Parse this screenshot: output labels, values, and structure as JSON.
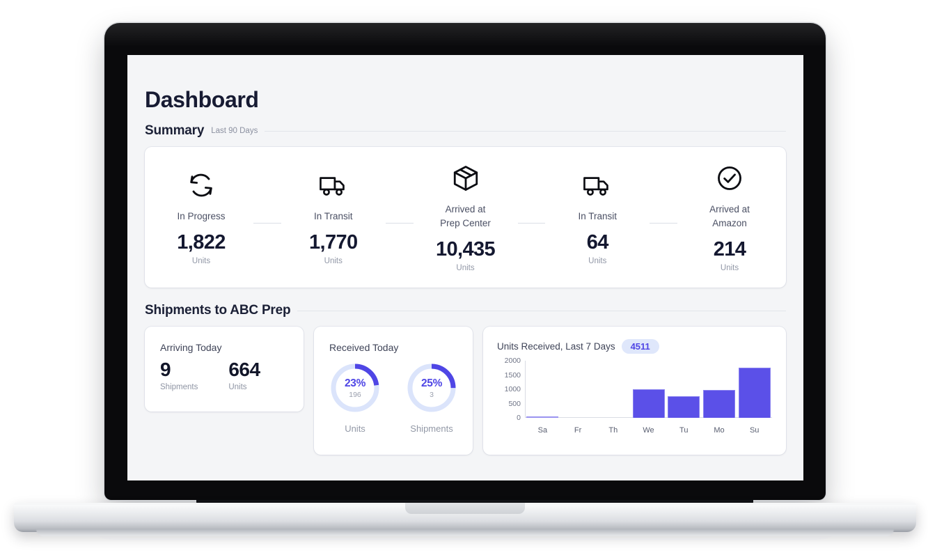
{
  "page": {
    "title": "Dashboard"
  },
  "summary": {
    "heading": "Summary",
    "subheading": "Last 90 Days",
    "items": [
      {
        "icon": "refresh-icon",
        "label": "In Progress",
        "value": "1,822",
        "units": "Units"
      },
      {
        "icon": "truck-icon",
        "label": "In Transit",
        "value": "1,770",
        "units": "Units"
      },
      {
        "icon": "box-icon",
        "label": "Arrived at\nPrep Center",
        "label_line1": "Arrived at",
        "label_line2": "Prep Center",
        "value": "10,435",
        "units": "Units"
      },
      {
        "icon": "truck-icon",
        "label": "In Transit",
        "value": "64",
        "units": "Units"
      },
      {
        "icon": "check-circle-icon",
        "label": "Arrived at\nAmazon",
        "label_line1": "Arrived at",
        "label_line2": "Amazon",
        "value": "214",
        "units": "Units"
      }
    ]
  },
  "shipments": {
    "heading": "Shipments to ABC Prep",
    "arriving_today": {
      "title": "Arriving Today",
      "shipments_value": "9",
      "shipments_caption": "Shipments",
      "units_value": "664",
      "units_caption": "Units"
    },
    "received_today": {
      "title": "Received Today",
      "donuts": [
        {
          "percent_label": "23%",
          "percent": 23,
          "sub": "196",
          "caption": "Units"
        },
        {
          "percent_label": "25%",
          "percent": 25,
          "sub": "3",
          "caption": "Shipments"
        }
      ]
    }
  },
  "colors": {
    "accent": "#4f46e5",
    "bar": "#5b50e8",
    "track": "#dbe4fb",
    "badge_bg": "#dfe7fb",
    "page_bg": "#f4f5f7"
  },
  "chart_data": {
    "type": "bar",
    "title": "Units Received, Last 7 Days",
    "total_badge": "4511",
    "categories": [
      "Sa",
      "Fr",
      "Th",
      "We",
      "Tu",
      "Mo",
      "Su"
    ],
    "values": [
      15,
      0,
      0,
      1000,
      750,
      980,
      1750
    ],
    "xlabel": "",
    "ylabel": "",
    "ylim": [
      0,
      2000
    ],
    "yticks": [
      2000,
      1500,
      1000,
      500,
      0
    ],
    "grid": false,
    "legend": false,
    "series_color": "#5b50e8"
  }
}
